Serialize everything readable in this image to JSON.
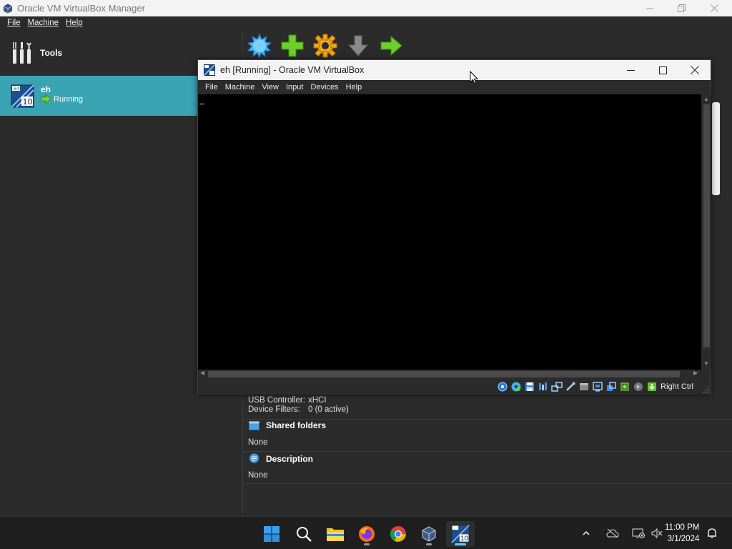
{
  "manager": {
    "title": "Oracle VM VirtualBox Manager",
    "menu": [
      "File",
      "Machine",
      "Help"
    ],
    "tools_label": "Tools",
    "vm": {
      "name": "eh",
      "state": "Running",
      "os_badge": "10"
    }
  },
  "details": {
    "usb_controller_key": "USB Controller:",
    "usb_controller_val": "xHCI",
    "device_filters_key": "Device Filters:",
    "device_filters_val": "0 (0 active)",
    "shared_folders_title": "Shared folders",
    "shared_folders_val": "None",
    "description_title": "Description",
    "description_val": "None"
  },
  "vm_window": {
    "title": "eh [Running] - Oracle VM VirtualBox",
    "menu": [
      "File",
      "Machine",
      "View",
      "Input",
      "Devices",
      "Help"
    ],
    "host_key": "Right Ctrl"
  },
  "taskbar": {
    "time": "11:00 PM",
    "date": "3/1/2024"
  },
  "colors": {
    "selection": "#3aa3b4",
    "accent": "#60cdff"
  }
}
